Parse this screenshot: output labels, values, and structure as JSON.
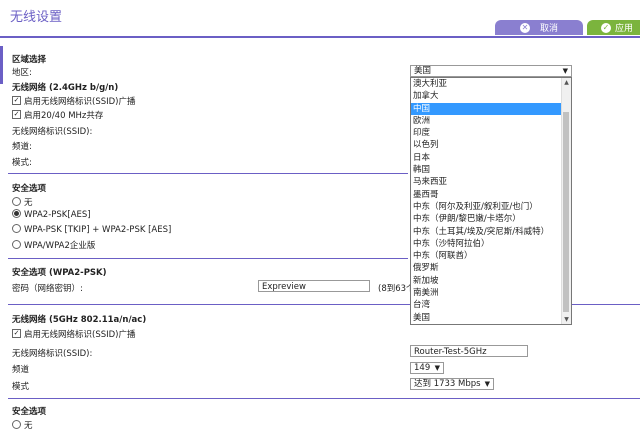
{
  "title": "无线设置",
  "toolbar": {
    "cancel_label": "取消",
    "apply_label": "应用"
  },
  "region": {
    "section_title": "区域选择",
    "area_label": "地区:",
    "area_value": "美国",
    "options": [
      "澳大利亚",
      "加拿大",
      "中国",
      "欧洲",
      "印度",
      "以色列",
      "日本",
      "韩国",
      "马来西亚",
      "墨西哥",
      "中东（阿尔及利亚/叙利亚/也门）",
      "中东（伊朗/黎巴嫩/卡塔尔）",
      "中东（土耳其/埃及/突尼斯/科威特）",
      "中东（沙特阿拉伯）",
      "中东（阿联酋）",
      "俄罗斯",
      "新加坡",
      "南美洲",
      "台湾",
      "美国"
    ],
    "selected_option": "中国"
  },
  "wireless24": {
    "section_title": "无线网络 (2.4GHz b/g/n)",
    "ssid_broadcast": "启用无线网络标识(SSID)广播",
    "coexist": "启用20/40 MHz共存",
    "ssid_label": "无线网络标识(SSID):",
    "channel_label": "频道:",
    "mode_label": "模式:"
  },
  "security": {
    "section_title": "安全选项",
    "options": [
      "无",
      "WPA2-PSK[AES]",
      "WPA-PSK [TKIP] + WPA2-PSK [AES]",
      "WPA/WPA2企业版"
    ],
    "selected_index": 1
  },
  "wpa2": {
    "section_title": "安全选项 (WPA2-PSK)",
    "password_label": "密码（网络密钥）:",
    "password_value": "Expreview",
    "hint": "(8到63个"
  },
  "wireless5": {
    "section_title": "无线网络 (5GHz 802.11a/n/ac)",
    "ssid_broadcast": "启用无线网络标识(SSID)广播",
    "ssid_label": "无线网络标识(SSID):",
    "ssid_value": "Router-Test-5GHz",
    "channel_label": "频道",
    "channel_value": "149",
    "mode_label": "模式",
    "mode_value": "达到 1733 Mbps"
  },
  "security5": {
    "section_title": "安全选项",
    "first_option": "无"
  }
}
